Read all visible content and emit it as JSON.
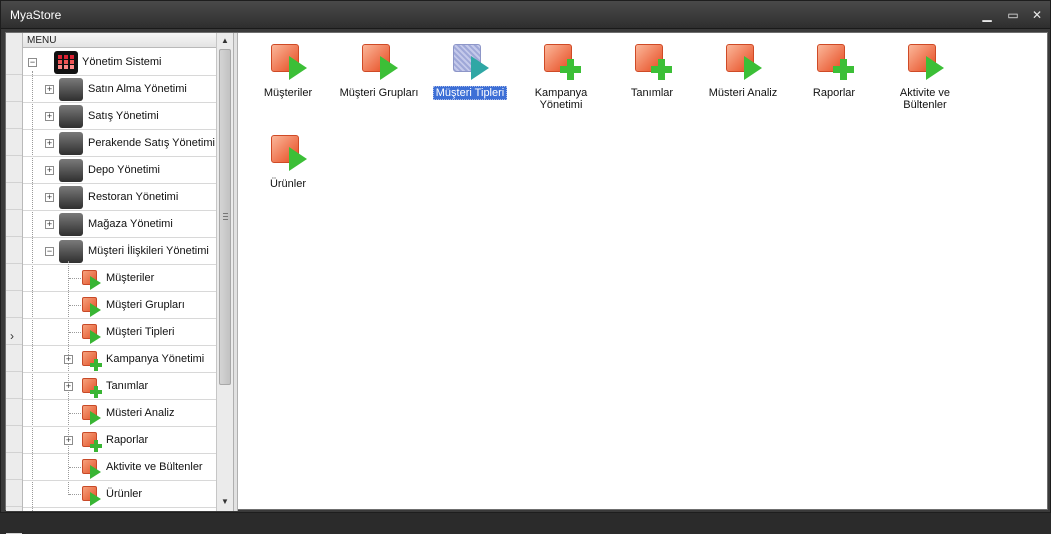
{
  "window": {
    "title": "MyaStore",
    "controls": {
      "minimize": "▁",
      "maximize": "▭",
      "close": "✕"
    }
  },
  "tree": {
    "header": "MENU",
    "root": {
      "label": "Yönetim Sistemi",
      "icon": "grid-app-icon",
      "expander": "−"
    },
    "modules": [
      {
        "label": "Satın Alma Yönetimi",
        "icon": "purchase-icon",
        "expander": "+"
      },
      {
        "label": "Satış Yönetimi",
        "icon": "truck-icon",
        "expander": "+"
      },
      {
        "label": "Perakende Satış Yönetimi",
        "icon": "barcode-icon",
        "expander": "+"
      },
      {
        "label": "Depo Yönetimi",
        "icon": "warehouse-icon",
        "expander": "+"
      },
      {
        "label": "Restoran Yönetimi",
        "icon": "restaurant-icon",
        "expander": "+"
      },
      {
        "label": "Mağaza Yönetimi",
        "icon": "store-icon",
        "expander": "+"
      },
      {
        "label": "Müşteri İlişkileri Yönetimi",
        "icon": "crm-icon",
        "expander": "−"
      }
    ],
    "crm_children": [
      {
        "label": "Müşteriler",
        "type": "play"
      },
      {
        "label": "Müşteri Grupları",
        "type": "play"
      },
      {
        "label": "Müşteri Tipleri",
        "type": "play"
      },
      {
        "label": "Kampanya Yönetimi",
        "type": "plus",
        "expander": "+"
      },
      {
        "label": "Tanımlar",
        "type": "plus",
        "expander": "+"
      },
      {
        "label": "Müsteri Analiz",
        "type": "play"
      },
      {
        "label": "Raporlar",
        "type": "plus",
        "expander": "+"
      },
      {
        "label": "Aktivite ve Bültenler",
        "type": "play"
      },
      {
        "label": "Ürünler",
        "type": "play"
      }
    ]
  },
  "indicator": {
    "current_row_marker": "›"
  },
  "scrollbar": {
    "up": "▲",
    "down": "▼"
  },
  "main": {
    "tiles": [
      {
        "label": "Müşteriler",
        "type": "play",
        "selected": false
      },
      {
        "label": "Müşteri Grupları",
        "type": "play",
        "selected": false
      },
      {
        "label": "Müşteri Tipleri",
        "type": "play",
        "selected": true
      },
      {
        "label": "Kampanya Yönetimi",
        "type": "plus",
        "selected": false
      },
      {
        "label": "Tanımlar",
        "type": "plus",
        "selected": false
      },
      {
        "label": "Müsteri Analiz",
        "type": "play",
        "selected": false
      },
      {
        "label": "Raporlar",
        "type": "plus",
        "selected": false
      },
      {
        "label": "Aktivite ve Bültenler",
        "type": "play",
        "selected": false
      },
      {
        "label": "Ürünler",
        "type": "play",
        "selected": false
      }
    ]
  }
}
